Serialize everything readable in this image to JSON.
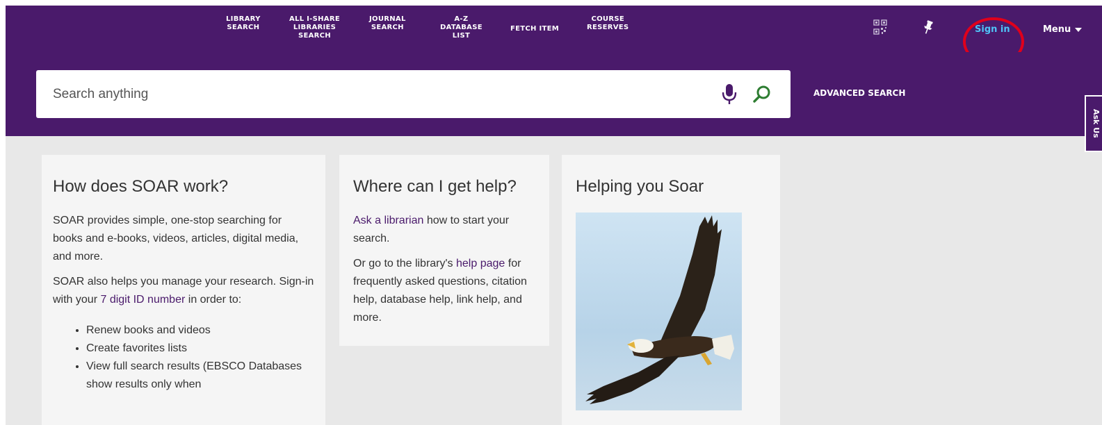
{
  "nav": {
    "items": [
      {
        "lines": [
          "LIBRARY",
          "SEARCH"
        ]
      },
      {
        "lines": [
          "ALL I-SHARE",
          "LIBRARIES",
          "SEARCH"
        ]
      },
      {
        "lines": [
          "JOURNAL",
          "SEARCH"
        ]
      },
      {
        "lines": [
          "A-Z",
          "DATABASE",
          "LIST"
        ]
      },
      {
        "lines": [
          "FETCH ITEM"
        ]
      },
      {
        "lines": [
          "COURSE",
          "RESERVES"
        ]
      }
    ],
    "sign_in": "Sign in",
    "menu": "Menu"
  },
  "search": {
    "placeholder": "Search anything",
    "advanced": "ADVANCED SEARCH"
  },
  "ask_us": "Ask Us",
  "cards": {
    "soar": {
      "title": "How does SOAR work?",
      "p1": "SOAR provides simple, one-stop searching for books and e-books, videos, articles, digital media, and more.",
      "p2_before": "SOAR also helps you manage your research. Sign-in with your ",
      "p2_link": "7 digit ID number",
      "p2_after": " in order to:",
      "bullets": [
        "Renew books and videos",
        "Create favorites lists",
        "View full search results (EBSCO Databases show results only when"
      ]
    },
    "help": {
      "title": "Where can I get help?",
      "p1_link": "Ask a librarian",
      "p1_after": " how to start your search.",
      "p2_before": "Or go to the library's ",
      "p2_link": "help page",
      "p2_after": " for frequently asked questions, citation help, database help, link help, and more."
    },
    "soar_help": {
      "title": "Helping you Soar"
    }
  },
  "colors": {
    "brand_purple": "#4a1a6b",
    "signin_blue": "#4fc3f7",
    "highlight_red": "#e0001b",
    "search_green": "#2e7d32"
  },
  "icons": {
    "qr": "qr-code-icon",
    "pin": "pin-icon",
    "mic": "microphone-icon",
    "search": "search-icon"
  }
}
